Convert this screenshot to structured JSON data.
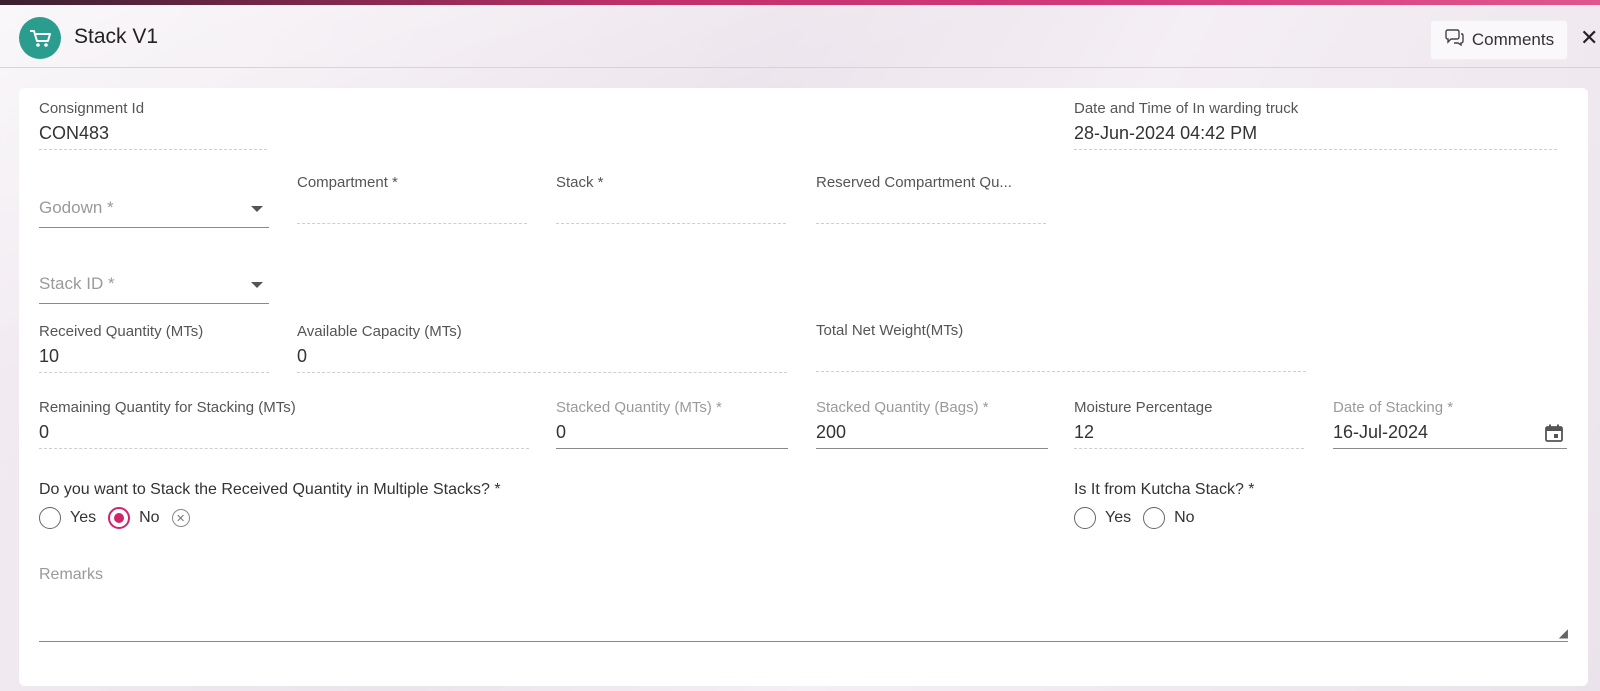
{
  "header": {
    "title": "Stack V1",
    "comments_label": "Comments",
    "close_glyph": "✕"
  },
  "fields": {
    "consignment": {
      "label": "Consignment Id",
      "value": "CON483"
    },
    "datetime": {
      "label": "Date and Time of In warding truck",
      "value": "28-Jun-2024 04:42 PM"
    },
    "godown": {
      "placeholder": "Godown *"
    },
    "compartment": {
      "label": "Compartment *",
      "value": ""
    },
    "stack": {
      "label": "Stack *",
      "value": ""
    },
    "reserved": {
      "label": "Reserved Compartment Qu...",
      "value": ""
    },
    "stack_id": {
      "placeholder": "Stack ID *"
    },
    "received": {
      "label": "Received Quantity (MTs)",
      "value": "10"
    },
    "available": {
      "label": "Available Capacity (MTs)",
      "value": "0"
    },
    "total_net": {
      "label": "Total Net Weight(MTs)",
      "value": ""
    },
    "remaining": {
      "label": "Remaining Quantity for Stacking (MTs)",
      "value": "0"
    },
    "stacked_mts": {
      "label": "Stacked Quantity (MTs) *",
      "value": "0"
    },
    "stacked_bags": {
      "label": "Stacked Quantity (Bags) *",
      "value": "200"
    },
    "moisture": {
      "label": "Moisture Percentage",
      "value": "12"
    },
    "date_stacking": {
      "label": "Date of Stacking *",
      "value": "16-Jul-2024"
    },
    "remarks": {
      "placeholder": "Remarks"
    }
  },
  "multi_stack": {
    "question": "Do you want to Stack the Received Quantity in Multiple Stacks? *",
    "yes": "Yes",
    "no": "No",
    "selected": "No"
  },
  "kutcha": {
    "question": "Is It from Kutcha Stack? *",
    "yes": "Yes",
    "no": "No",
    "selected": ""
  },
  "colors": {
    "accent": "#d1256a",
    "logo": "#2a9d8f"
  },
  "icons": [
    "cart-icon",
    "comment-icon",
    "close-icon",
    "dropdown-caret-icon",
    "calendar-icon",
    "clear-icon",
    "resize-handle-icon"
  ]
}
